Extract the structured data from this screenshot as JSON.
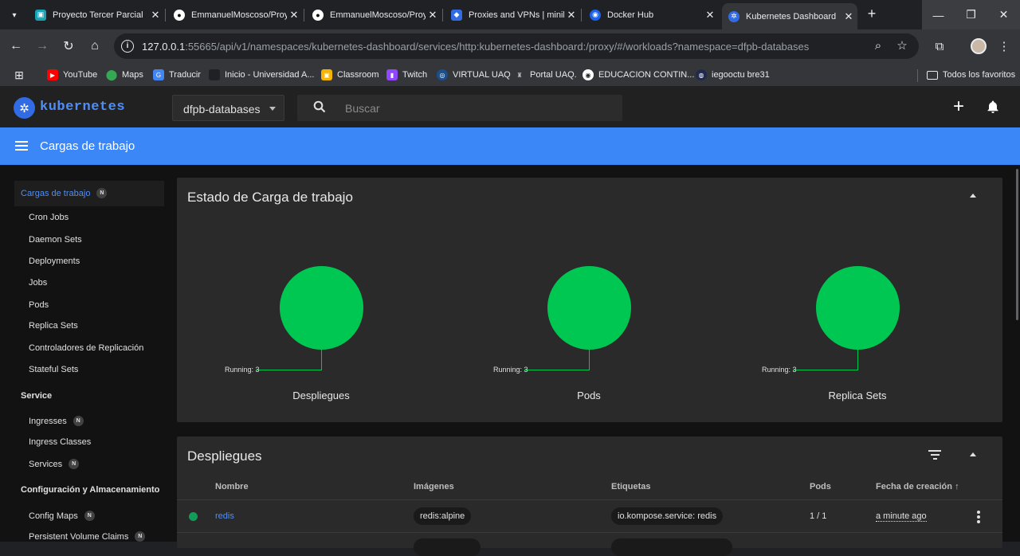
{
  "browser": {
    "tabs": [
      {
        "title": "Proyecto Tercer Parcial",
        "close": "✕"
      },
      {
        "title": "EmmanuelMoscoso/Proy",
        "close": "✕"
      },
      {
        "title": "EmmanuelMoscoso/Proy",
        "close": "✕"
      },
      {
        "title": "Proxies and VPNs | minik",
        "close": "✕"
      },
      {
        "title": "Docker Hub",
        "close": "✕"
      },
      {
        "title": "Kubernetes Dashboard",
        "close": "✕"
      }
    ],
    "new_tab": "+",
    "url_host": "127.0.0.1",
    "url_rest": ":55665/api/v1/namespaces/kubernetes-dashboard/services/http:kubernetes-dashboard:/proxy/#/workloads?namespace=dfpb-databases",
    "bookmarks": [
      {
        "label": "YouTube"
      },
      {
        "label": "Maps"
      },
      {
        "label": "Traducir"
      },
      {
        "label": "Inicio - Universidad A..."
      },
      {
        "label": "Classroom"
      },
      {
        "label": "Twitch"
      },
      {
        "label": "VIRTUAL UAQ"
      },
      {
        "label": "Portal UAQ."
      },
      {
        "label": "EDUCACION CONTIN..."
      },
      {
        "label": "iegooctu bre31"
      },
      {
        "label": "Todos los favoritos"
      }
    ],
    "colors": {
      "youtube": "#ff0000",
      "maps": "#34a853",
      "translate": "#4285f4",
      "classroom": "#f4b400",
      "twitch": "#9146ff"
    }
  },
  "k8s": {
    "brand": "kubernetes",
    "namespace": "dfpb-databases",
    "search_placeholder": "Buscar",
    "bar_title": "Cargas de trabajo",
    "sidebar": {
      "active": {
        "label": "Cargas de trabajo",
        "badge": "N"
      },
      "items": [
        {
          "label": "Cron Jobs"
        },
        {
          "label": "Daemon Sets"
        },
        {
          "label": "Deployments"
        },
        {
          "label": "Jobs"
        },
        {
          "label": "Pods"
        },
        {
          "label": "Replica Sets"
        },
        {
          "label": "Controladores de Replicación"
        },
        {
          "label": "Stateful Sets"
        }
      ],
      "service_header": "Service",
      "service_items": [
        {
          "label": "Ingresses",
          "badge": "N"
        },
        {
          "label": "Ingress Classes"
        },
        {
          "label": "Services",
          "badge": "N"
        }
      ],
      "config_header": "Configuración y Almacenamiento",
      "config_items": [
        {
          "label": "Config Maps",
          "badge": "N"
        },
        {
          "label": "Persistent Volume Claims",
          "badge": "N"
        }
      ]
    },
    "status_card": {
      "title": "Estado de Carga de trabajo",
      "charts": [
        {
          "name": "Despliegues",
          "running_label": "Running: 3",
          "running": 3
        },
        {
          "name": "Pods",
          "running_label": "Running: 3",
          "running": 3
        },
        {
          "name": "Replica Sets",
          "running_label": "Running: 3",
          "running": 3
        }
      ],
      "running_color": "#00c752"
    },
    "deployments_card": {
      "title": "Despliegues",
      "columns": [
        "Nombre",
        "Imágenes",
        "Etiquetas",
        "Pods",
        "Fecha de creación"
      ],
      "sort_arrow": "↑",
      "rows": [
        {
          "name": "redis",
          "image": "redis:alpine",
          "label": "io.kompose.service: redis",
          "pods": "1 / 1",
          "created": "a minute ago"
        }
      ]
    }
  }
}
